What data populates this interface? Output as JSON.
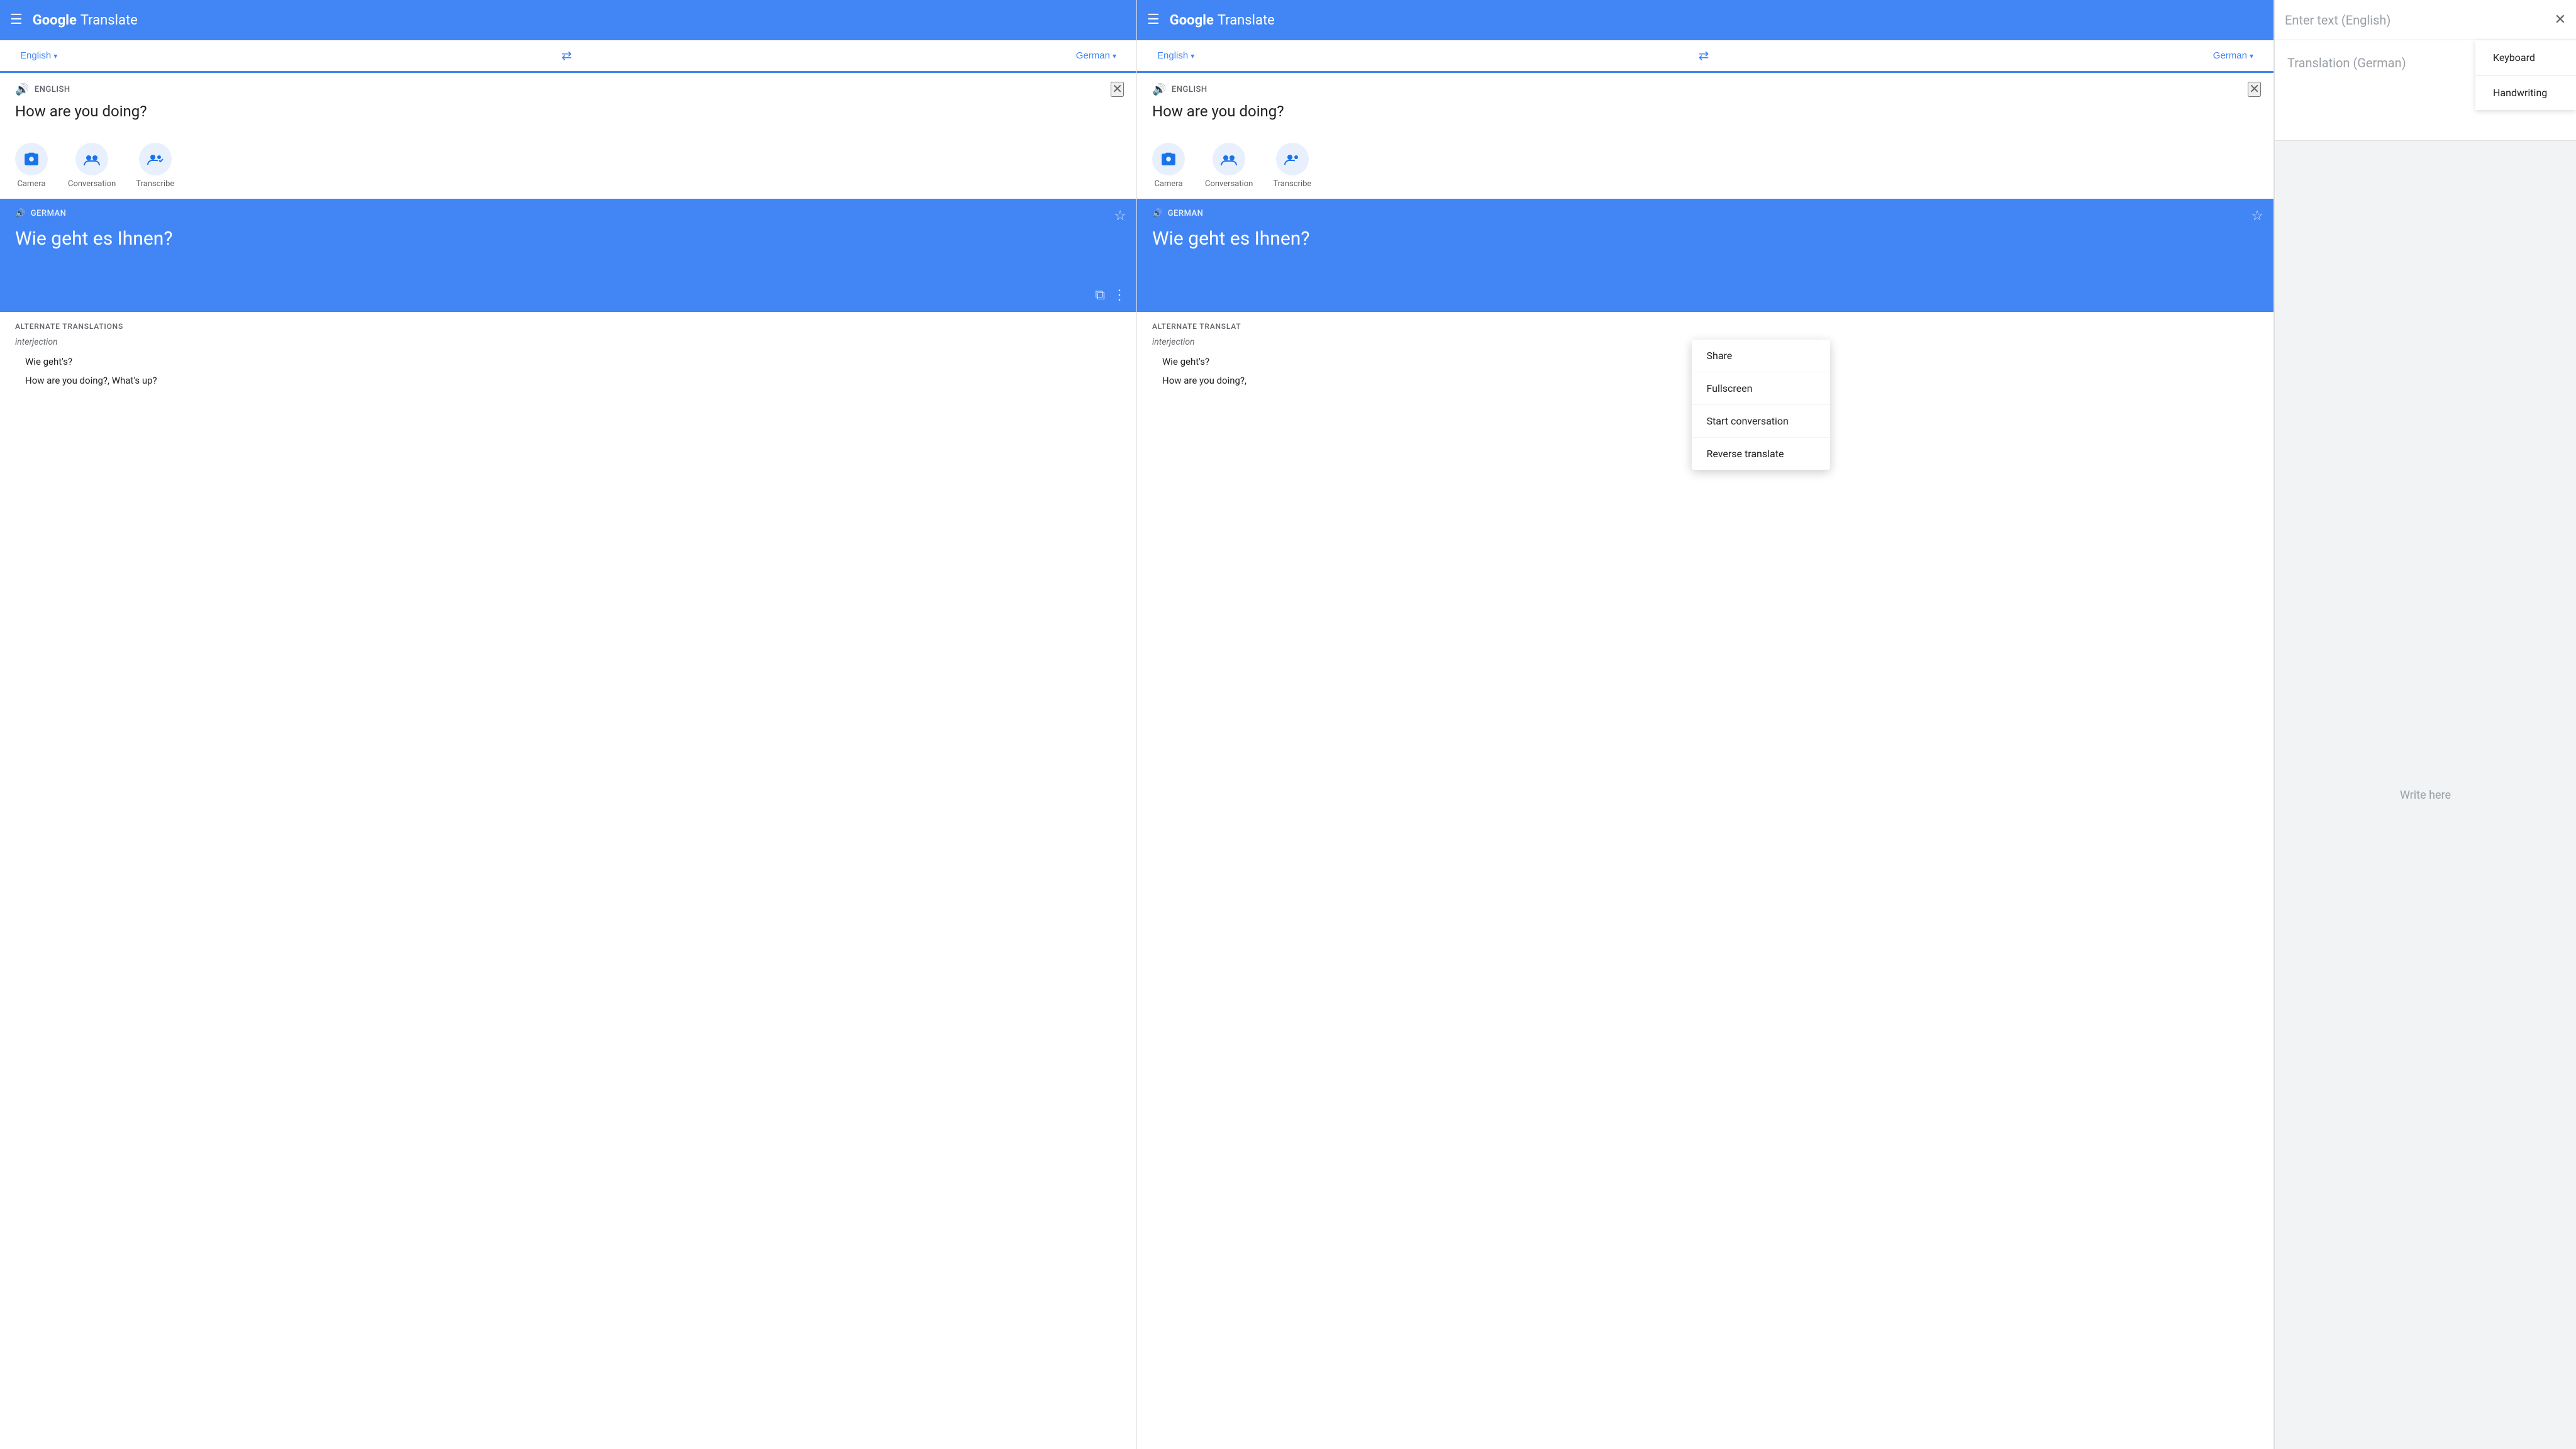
{
  "app": {
    "name": "Google Translate"
  },
  "panel1": {
    "header": {
      "menu_label": "☰",
      "brand_google": "Google",
      "brand_translate": "Translate"
    },
    "lang_bar": {
      "source_lang": "English",
      "target_lang": "German",
      "swap_icon": "⇄"
    },
    "source": {
      "lang_label": "ENGLISH",
      "speaker_icon": "🔊",
      "close_icon": "✕",
      "text": "How are you doing?"
    },
    "features": [
      {
        "id": "camera",
        "label": "Camera"
      },
      {
        "id": "conversation",
        "label": "Conversation"
      },
      {
        "id": "transcribe",
        "label": "Transcribe"
      }
    ],
    "translation": {
      "lang_label": "GERMAN",
      "speaker_icon": "🔊",
      "text": "Wie geht es Ihnen?",
      "star_icon": "☆",
      "copy_icon": "⧉",
      "more_icon": "⋮"
    },
    "alt_translations": {
      "title": "ALTERNATE TRANSLATIONS",
      "pos": "interjection",
      "items": [
        "Wie geht's?",
        "How are you doing?, What's up?"
      ]
    }
  },
  "panel2": {
    "header": {
      "menu_label": "☰",
      "brand_google": "Google",
      "brand_translate": "Translate"
    },
    "lang_bar": {
      "source_lang": "English",
      "target_lang": "German",
      "swap_icon": "⇄"
    },
    "source": {
      "lang_label": "ENGLISH",
      "speaker_icon": "🔊",
      "close_icon": "✕",
      "text": "How are you doing?"
    },
    "features": [
      {
        "id": "camera",
        "label": "Camera"
      },
      {
        "id": "conversation",
        "label": "Conversation"
      },
      {
        "id": "transcribe",
        "label": "Transcribe"
      }
    ],
    "translation": {
      "lang_label": "GERMAN",
      "speaker_icon": "🔊",
      "text": "Wie geht es Ihnen?",
      "star_icon": "☆",
      "copy_icon": "⧉",
      "more_icon": "⋮"
    },
    "alt_translations": {
      "title": "ALTERNATE TRANSLAT",
      "pos": "interjection",
      "items": [
        "Wie geht's?",
        "How are you doing?,"
      ]
    },
    "context_menu": {
      "items": [
        "Share",
        "Fullscreen",
        "Start conversation",
        "Reverse translate"
      ]
    }
  },
  "input_panel": {
    "placeholder": "Enter text (English)",
    "close_icon": "✕",
    "translation_placeholder": "Translation (German)",
    "write_label": "Write here",
    "input_methods": [
      "Keyboard",
      "Handwriting"
    ]
  },
  "colors": {
    "blue": "#4285f4",
    "blue_dark": "#1a73e8",
    "text_dark": "#202124",
    "text_medium": "#5f6368",
    "text_light": "#9aa0a6",
    "bg_light": "#f1f3f4",
    "white": "#ffffff"
  }
}
